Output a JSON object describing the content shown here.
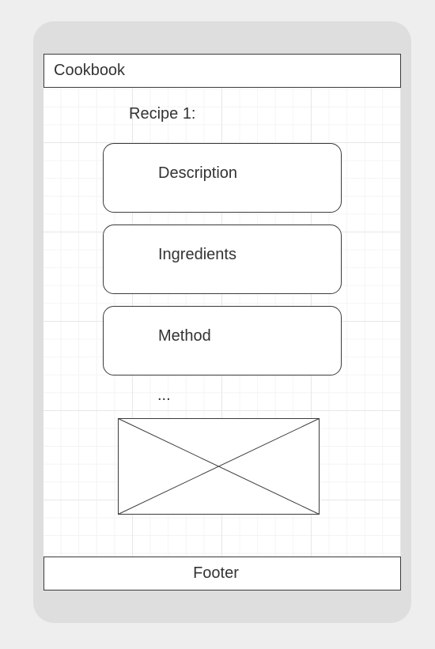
{
  "header": {
    "title": "Cookbook"
  },
  "recipe": {
    "label": "Recipe 1:",
    "sections": [
      {
        "label": "Description"
      },
      {
        "label": "Ingredients"
      },
      {
        "label": "Method"
      }
    ],
    "more": "..."
  },
  "image": {
    "icon": "image-placeholder-icon"
  },
  "footer": {
    "text": "Footer"
  },
  "colors": {
    "background": "#eeeeee",
    "device": "#dedede",
    "border": "#3a3a3a",
    "text": "#333333"
  }
}
